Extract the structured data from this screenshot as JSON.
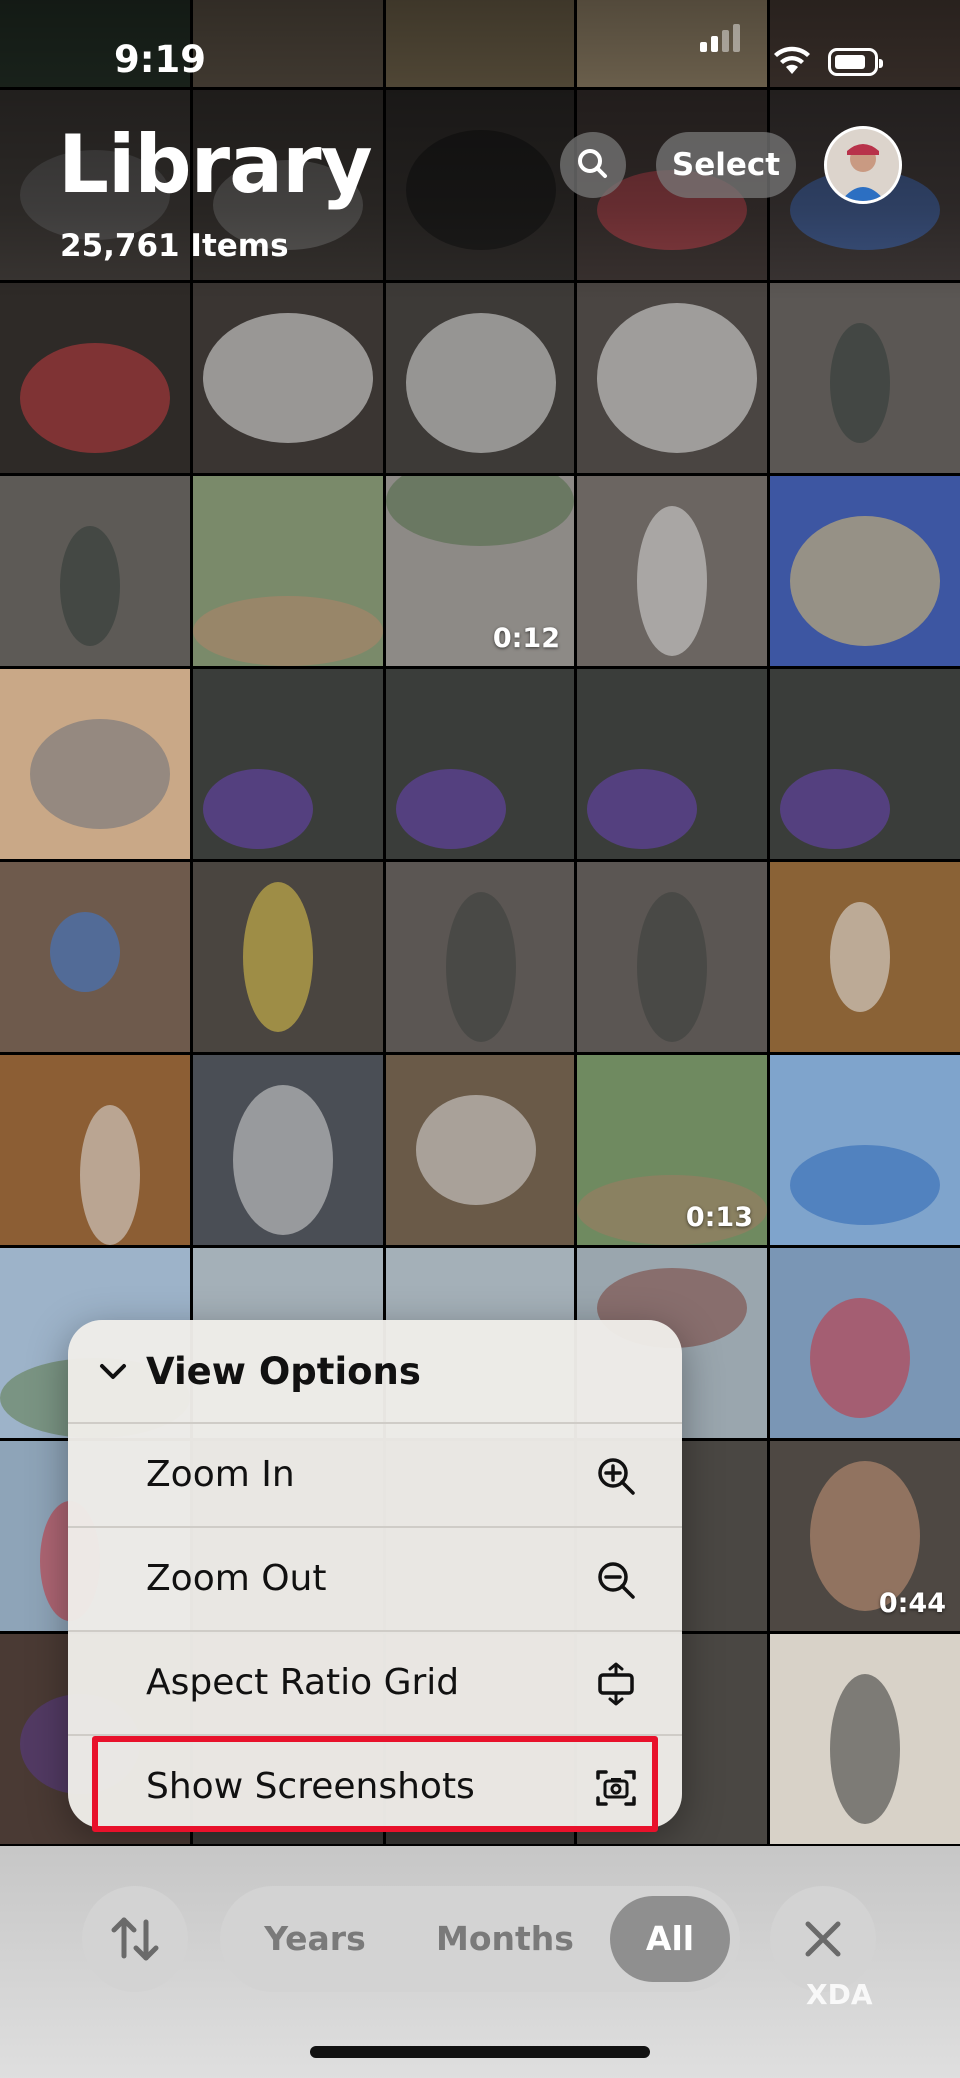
{
  "status_bar": {
    "time": "9:19"
  },
  "header": {
    "title": "Library",
    "item_count": "25,761 Items",
    "select_label": "Select"
  },
  "grid": {
    "video_durations": [
      "0:12",
      "0:13",
      "0:44"
    ]
  },
  "view_options_menu": {
    "title": "View Options",
    "items": [
      {
        "label": "Zoom In",
        "icon": "zoom-in-icon"
      },
      {
        "label": "Zoom Out",
        "icon": "zoom-out-icon"
      },
      {
        "label": "Aspect Ratio Grid",
        "icon": "aspect-ratio-icon"
      },
      {
        "label": "Show Screenshots",
        "icon": "screenshot-icon",
        "highlighted": true
      }
    ]
  },
  "bottom_bar": {
    "segments": [
      "Years",
      "Months",
      "All"
    ],
    "selected": "All"
  },
  "watermark": "XDA",
  "colors": {
    "highlight_border": "#e8112b",
    "menu_bg": "#eeece8"
  }
}
